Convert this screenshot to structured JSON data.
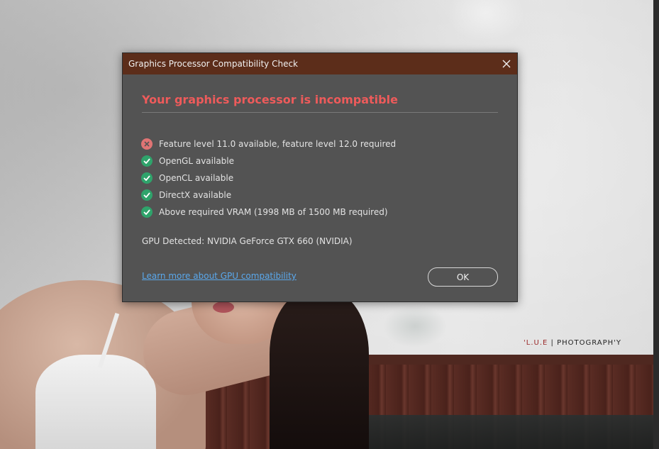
{
  "window": {
    "title": "Graphics Processor Compatibility Check",
    "close_icon": "close-icon"
  },
  "dialog": {
    "headline": "Your graphics processor is incompatible",
    "checks": [
      {
        "label": "Feature level 11.0 available, feature level 12.0 required",
        "status": "fail",
        "icon": "x-circle-icon"
      },
      {
        "label": "OpenGL available",
        "status": "pass",
        "icon": "check-circle-icon"
      },
      {
        "label": "OpenCL available",
        "status": "pass",
        "icon": "check-circle-icon"
      },
      {
        "label": "DirectX available",
        "status": "pass",
        "icon": "check-circle-icon"
      },
      {
        "label": "Above required VRAM (1998 MB of 1500 MB required)",
        "status": "pass",
        "icon": "check-circle-icon"
      }
    ],
    "gpu_detected": "GPU Detected: NVIDIA GeForce GTX 660 (NVIDIA)",
    "learn_more_link": "Learn more about GPU compatibility",
    "ok_label": "OK"
  },
  "background": {
    "watermark_brand": "'L.U.E",
    "watermark_separator": "|",
    "watermark_text": "PHOTOGRAPH'Y"
  },
  "colors": {
    "titlebar": "#5c2d1a",
    "dialog_bg": "#535353",
    "headline": "#ee5b5b",
    "fail": "#e07474",
    "pass": "#2fa36b",
    "link": "#5aa8ec"
  }
}
